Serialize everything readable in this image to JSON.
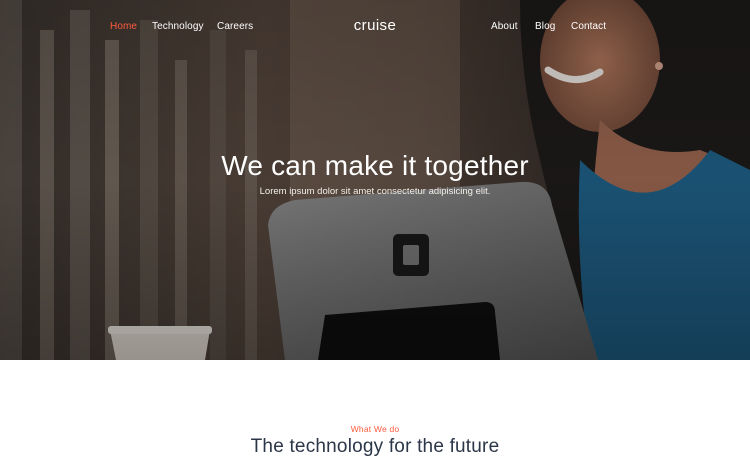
{
  "nav": {
    "left": [
      "Home",
      "Technology",
      "Careers"
    ],
    "brand": "cruise",
    "right": [
      "About",
      "Blog",
      "Contact"
    ],
    "active_item": "Home"
  },
  "hero": {
    "title": "We can make it together",
    "subtitle": "Lorem ipsum dolor sit amet consectetur adipisicing elit."
  },
  "section": {
    "eyebrow": "What We do",
    "title": "The technology for the future"
  },
  "colors": {
    "accent": "#ff5b3f",
    "heading": "#2b3648",
    "hero_overlay": "#1a1714"
  }
}
